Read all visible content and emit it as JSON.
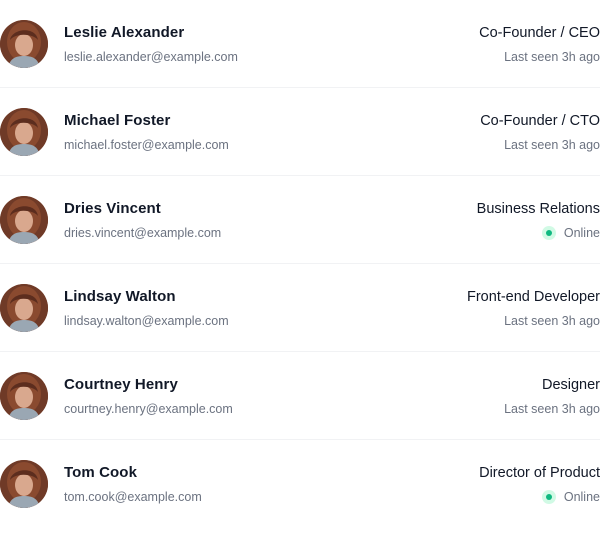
{
  "people": [
    {
      "name": "Leslie Alexander",
      "email": "leslie.alexander@example.com",
      "role": "Co-Founder / CEO",
      "status": "Last seen 3h ago",
      "online": false
    },
    {
      "name": "Michael Foster",
      "email": "michael.foster@example.com",
      "role": "Co-Founder / CTO",
      "status": "Last seen 3h ago",
      "online": false
    },
    {
      "name": "Dries Vincent",
      "email": "dries.vincent@example.com",
      "role": "Business Relations",
      "status": "Online",
      "online": true
    },
    {
      "name": "Lindsay Walton",
      "email": "lindsay.walton@example.com",
      "role": "Front-end Developer",
      "status": "Last seen 3h ago",
      "online": false
    },
    {
      "name": "Courtney Henry",
      "email": "courtney.henry@example.com",
      "role": "Designer",
      "status": "Last seen 3h ago",
      "online": false
    },
    {
      "name": "Tom Cook",
      "email": "tom.cook@example.com",
      "role": "Director of Product",
      "status": "Online",
      "online": true
    }
  ],
  "colors": {
    "online_dot": "#10b981",
    "online_halo": "#d1fae5",
    "name_text": "#111827",
    "secondary_text": "#6b7280"
  },
  "icons": {
    "avatar": "person-photo",
    "status_dot": "online-status-dot"
  }
}
